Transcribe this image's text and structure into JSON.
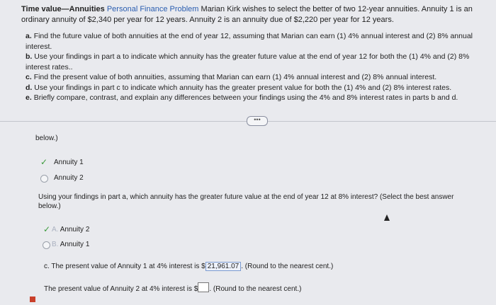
{
  "problem": {
    "title": "Time value—Annuities",
    "link": "Personal Finance Problem",
    "intro": "Marian Kirk wishes to select the better of two 12-year annuities. Annuity 1 is an ordinary annuity of $2,340 per year for 12 years. Annuity 2 is an annuity due of $2,220 per year for 12 years."
  },
  "parts": [
    {
      "label": "a.",
      "text": "Find the future value of both annuities at the end of year 12, assuming that Marian can earn (1) 4% annual interest and (2) 8% annual interest."
    },
    {
      "label": "b.",
      "text": "Use your findings in part a to indicate which annuity has the greater future value at the end of year 12 for both the (1) 4% and (2) 8% interest rates.."
    },
    {
      "label": "c.",
      "text": "Find the present value of both annuities, assuming that Marian can earn (1) 4% annual interest and (2) 8% annual interest."
    },
    {
      "label": "d.",
      "text": "Use your findings in part c to indicate which annuity has the greater present value for both the (1) 4% and (2) 8% interest rates."
    },
    {
      "label": "e.",
      "text": "Briefly compare, contrast, and explain any differences between your findings using the 4% and  8% interest rates in parts b and d."
    }
  ],
  "expand_label": "•••",
  "answers": {
    "below_text": "below.)",
    "q1_options": [
      "Annuity 1",
      "Annuity 2"
    ],
    "q2_text": "Using your findings in part a, which annuity has the greater future value at the end of year 12 at 8% interest? (Select the best answer below.)",
    "q2_options": [
      {
        "letter": "A.",
        "label": "Annuity 2"
      },
      {
        "letter": "B.",
        "label": "Annuity 1"
      }
    ],
    "pv1_prefix": "c. The present value of Annuity 1 at 4% interest is $",
    "pv1_value": "21,961.07",
    "pv1_suffix": ". (Round to the nearest cent.)",
    "pv2_prefix": "The present value of Annuity 2 at 4% interest is $",
    "pv2_suffix": ". (Round to the nearest cent.)"
  }
}
